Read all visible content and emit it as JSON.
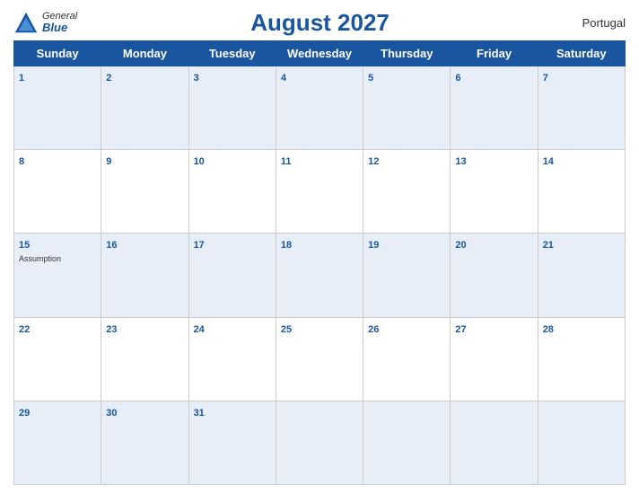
{
  "header": {
    "logo_general": "General",
    "logo_blue": "Blue",
    "title": "August 2027",
    "country": "Portugal"
  },
  "weekdays": [
    "Sunday",
    "Monday",
    "Tuesday",
    "Wednesday",
    "Thursday",
    "Friday",
    "Saturday"
  ],
  "weeks": [
    [
      {
        "day": 1,
        "holiday": ""
      },
      {
        "day": 2,
        "holiday": ""
      },
      {
        "day": 3,
        "holiday": ""
      },
      {
        "day": 4,
        "holiday": ""
      },
      {
        "day": 5,
        "holiday": ""
      },
      {
        "day": 6,
        "holiday": ""
      },
      {
        "day": 7,
        "holiday": ""
      }
    ],
    [
      {
        "day": 8,
        "holiday": ""
      },
      {
        "day": 9,
        "holiday": ""
      },
      {
        "day": 10,
        "holiday": ""
      },
      {
        "day": 11,
        "holiday": ""
      },
      {
        "day": 12,
        "holiday": ""
      },
      {
        "day": 13,
        "holiday": ""
      },
      {
        "day": 14,
        "holiday": ""
      }
    ],
    [
      {
        "day": 15,
        "holiday": "Assumption"
      },
      {
        "day": 16,
        "holiday": ""
      },
      {
        "day": 17,
        "holiday": ""
      },
      {
        "day": 18,
        "holiday": ""
      },
      {
        "day": 19,
        "holiday": ""
      },
      {
        "day": 20,
        "holiday": ""
      },
      {
        "day": 21,
        "holiday": ""
      }
    ],
    [
      {
        "day": 22,
        "holiday": ""
      },
      {
        "day": 23,
        "holiday": ""
      },
      {
        "day": 24,
        "holiday": ""
      },
      {
        "day": 25,
        "holiday": ""
      },
      {
        "day": 26,
        "holiday": ""
      },
      {
        "day": 27,
        "holiday": ""
      },
      {
        "day": 28,
        "holiday": ""
      }
    ],
    [
      {
        "day": 29,
        "holiday": ""
      },
      {
        "day": 30,
        "holiday": ""
      },
      {
        "day": 31,
        "holiday": ""
      },
      {
        "day": null,
        "holiday": ""
      },
      {
        "day": null,
        "holiday": ""
      },
      {
        "day": null,
        "holiday": ""
      },
      {
        "day": null,
        "holiday": ""
      }
    ]
  ],
  "colors": {
    "header_bg": "#1a56a0",
    "header_text": "#ffffff",
    "odd_row_bg": "#e8eef8",
    "even_row_bg": "#ffffff",
    "date_num_color": "#1a56a0"
  }
}
